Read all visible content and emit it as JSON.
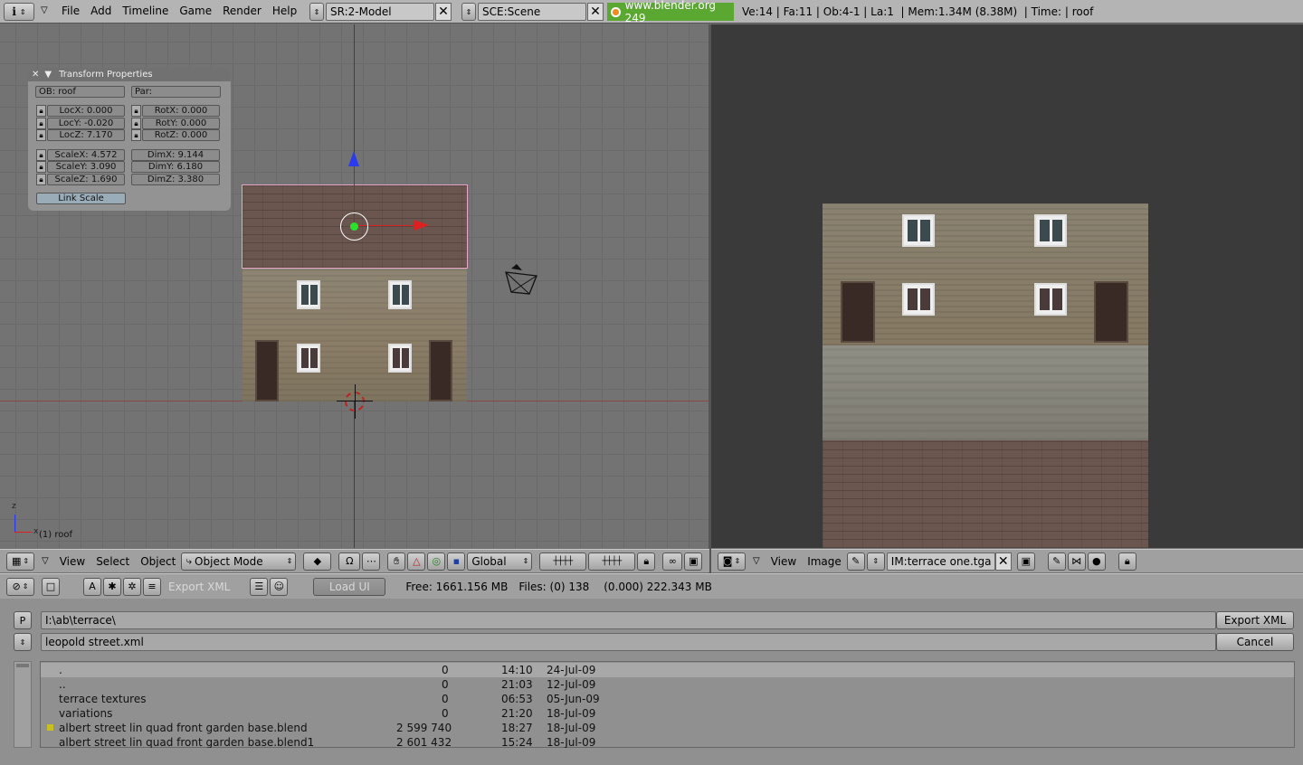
{
  "top": {
    "menus": [
      "File",
      "Add",
      "Timeline",
      "Game",
      "Render",
      "Help"
    ],
    "screen": "SR:2-Model",
    "scene": "SCE:Scene",
    "site": "www.blender.org 249",
    "stats": "Ve:14 | Fa:11 | Ob:4-1 | La:1  | Mem:1.34M (8.38M)  | Time: | roof"
  },
  "transform": {
    "title": "Transform Properties",
    "ob": "OB: roof",
    "par": "Par:",
    "locx": "LocX: 0.000",
    "locy": "LocY: -0.020",
    "locz": "LocZ: 7.170",
    "rotx": "RotX: 0.000",
    "roty": "RotY: 0.000",
    "rotz": "RotZ: 0.000",
    "scalex": "ScaleX: 4.572",
    "scaley": "ScaleY: 3.090",
    "scalez": "ScaleZ: 1.690",
    "dimx": "DimX: 9.144",
    "dimy": "DimY: 6.180",
    "dimz": "DimZ: 3.380",
    "link_scale": "Link Scale"
  },
  "viewport": {
    "obj_label": "(1) roof",
    "axis_z": "z",
    "axis_x": "x"
  },
  "view3d_header": {
    "view": "View",
    "select": "Select",
    "object": "Object",
    "mode": "Object Mode",
    "orientation": "Global"
  },
  "image_header": {
    "view": "View",
    "image": "Image",
    "image_name": "IM:terrace one.tga"
  },
  "filebrowser": {
    "export_label": "Export XML",
    "load_ui": "Load UI",
    "free": "Free: 1661.156 MB",
    "files": "Files: (0) 138",
    "total": "(0.000) 222.343 MB",
    "p_btn": "P",
    "path": "I:\\ab\\terrace\\",
    "filename": "leopold street.xml",
    "export_btn": "Export XML",
    "cancel_btn": "Cancel",
    "rows": [
      {
        "name": ".",
        "size": "0",
        "time": "14:10",
        "date": "24-Jul-09"
      },
      {
        "name": "..",
        "size": "0",
        "time": "21:03",
        "date": "12-Jul-09"
      },
      {
        "name": "terrace textures",
        "size": "0",
        "time": "06:53",
        "date": "05-Jun-09"
      },
      {
        "name": "variations",
        "size": "0",
        "time": "21:20",
        "date": "18-Jul-09"
      },
      {
        "name": "albert street  lin quad front garden base.blend",
        "size": "2 599 740",
        "time": "18:27",
        "date": "18-Jul-09"
      },
      {
        "name": "albert street  lin quad front garden base.blend1",
        "size": "2 601 432",
        "time": "15:24",
        "date": "18-Jul-09"
      }
    ]
  },
  "colors": {
    "roof": "#6b564f",
    "wall": "#8a7f6a",
    "door": "#3a2a26",
    "site_bg": "#5aa832"
  }
}
